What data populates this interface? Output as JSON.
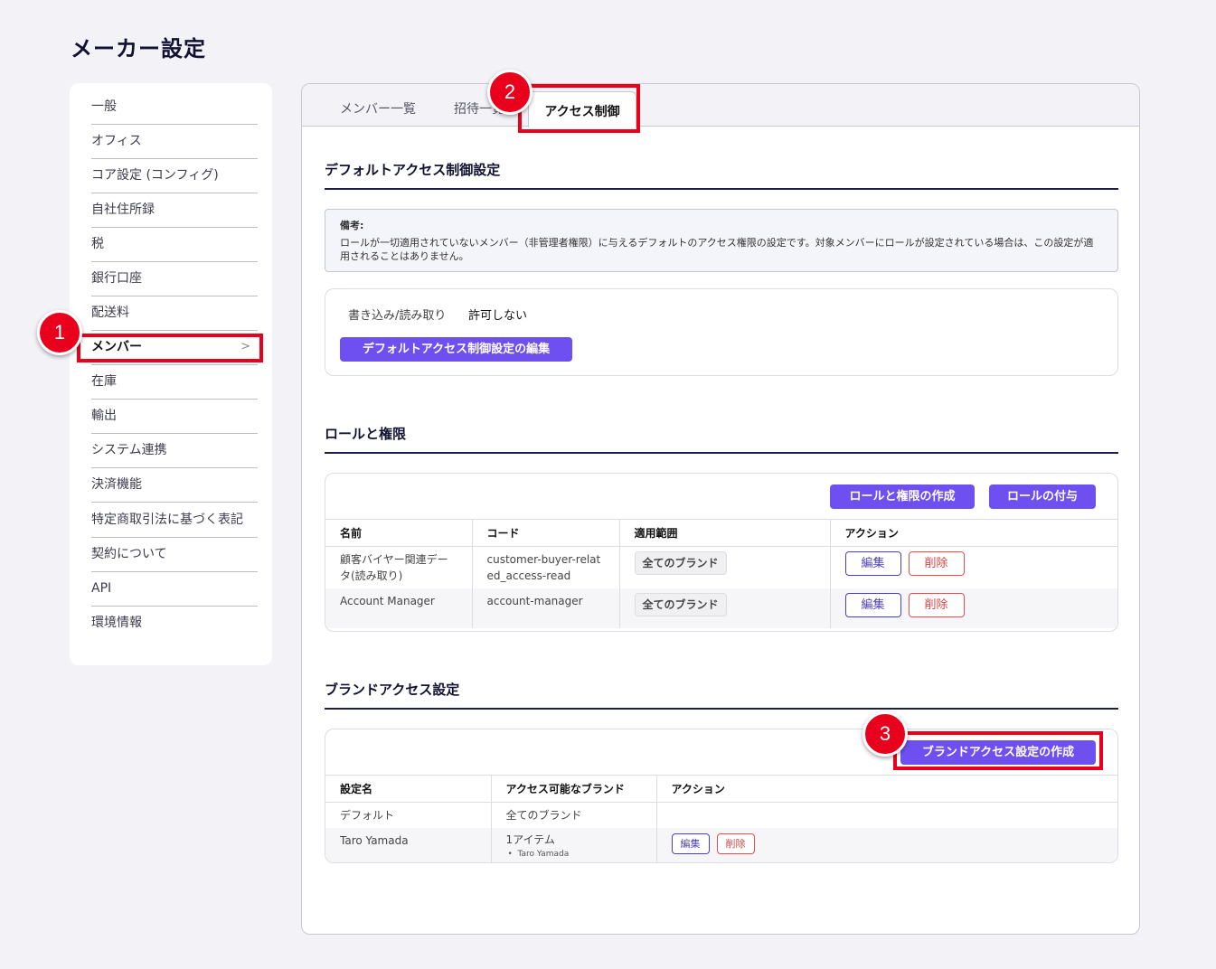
{
  "page": {
    "title": "メーカー設定"
  },
  "sidebar": {
    "items": [
      {
        "label": "一般"
      },
      {
        "label": "オフィス"
      },
      {
        "label": "コア設定 (コンフィグ)"
      },
      {
        "label": "自社住所録"
      },
      {
        "label": "税"
      },
      {
        "label": "銀行口座"
      },
      {
        "label": "配送料"
      },
      {
        "label": "メンバー",
        "chevron": ">"
      },
      {
        "label": "在庫"
      },
      {
        "label": "輸出"
      },
      {
        "label": "システム連携"
      },
      {
        "label": "決済機能"
      },
      {
        "label": "特定商取引法に基づく表記"
      },
      {
        "label": "契約について"
      },
      {
        "label": "API"
      },
      {
        "label": "環境情報"
      }
    ]
  },
  "tabs": [
    {
      "label": "メンバー一覧"
    },
    {
      "label": "招待一覧"
    },
    {
      "label": "アクセス制御"
    }
  ],
  "default_access": {
    "title": "デフォルトアクセス制御設定",
    "note_label": "備考:",
    "note_text": "ロールが一切適用されていないメンバー（非管理者権限）に与えるデフォルトのアクセス権限の設定です。対象メンバーにロールが設定されている場合は、この設定が適用されることはありません。",
    "perm_label": "書き込み/読み取り",
    "perm_value": "許可しない",
    "edit_button": "デフォルトアクセス制御設定の編集"
  },
  "roles": {
    "title": "ロールと権限",
    "create_button": "ロールと権限の作成",
    "assign_button": "ロールの付与",
    "columns": [
      "名前",
      "コード",
      "適用範囲",
      "アクション"
    ],
    "rows": [
      {
        "name": "顧客バイヤー関連データ(読み取り)",
        "code": "customer-buyer-related_access-read",
        "scope": "全てのブランド"
      },
      {
        "name": "Account Manager",
        "code": "account-manager",
        "scope": "全てのブランド"
      }
    ],
    "edit_label": "編集",
    "delete_label": "削除"
  },
  "brand_access": {
    "title": "ブランドアクセス設定",
    "create_button": "ブランドアクセス設定の作成",
    "columns": [
      "設定名",
      "アクセス可能なブランド",
      "アクション"
    ],
    "rows": [
      {
        "name": "デフォルト",
        "brands": "全てのブランド"
      },
      {
        "name": "Taro Yamada",
        "brands": "1アイテム",
        "brand_item": "Taro Yamada"
      }
    ],
    "edit_label": "編集",
    "delete_label": "削除"
  },
  "annotations": [
    "1",
    "2",
    "3"
  ],
  "colors": {
    "accent": "#6e4ff0",
    "annotation": "#e8001c",
    "danger": "#d84545"
  }
}
